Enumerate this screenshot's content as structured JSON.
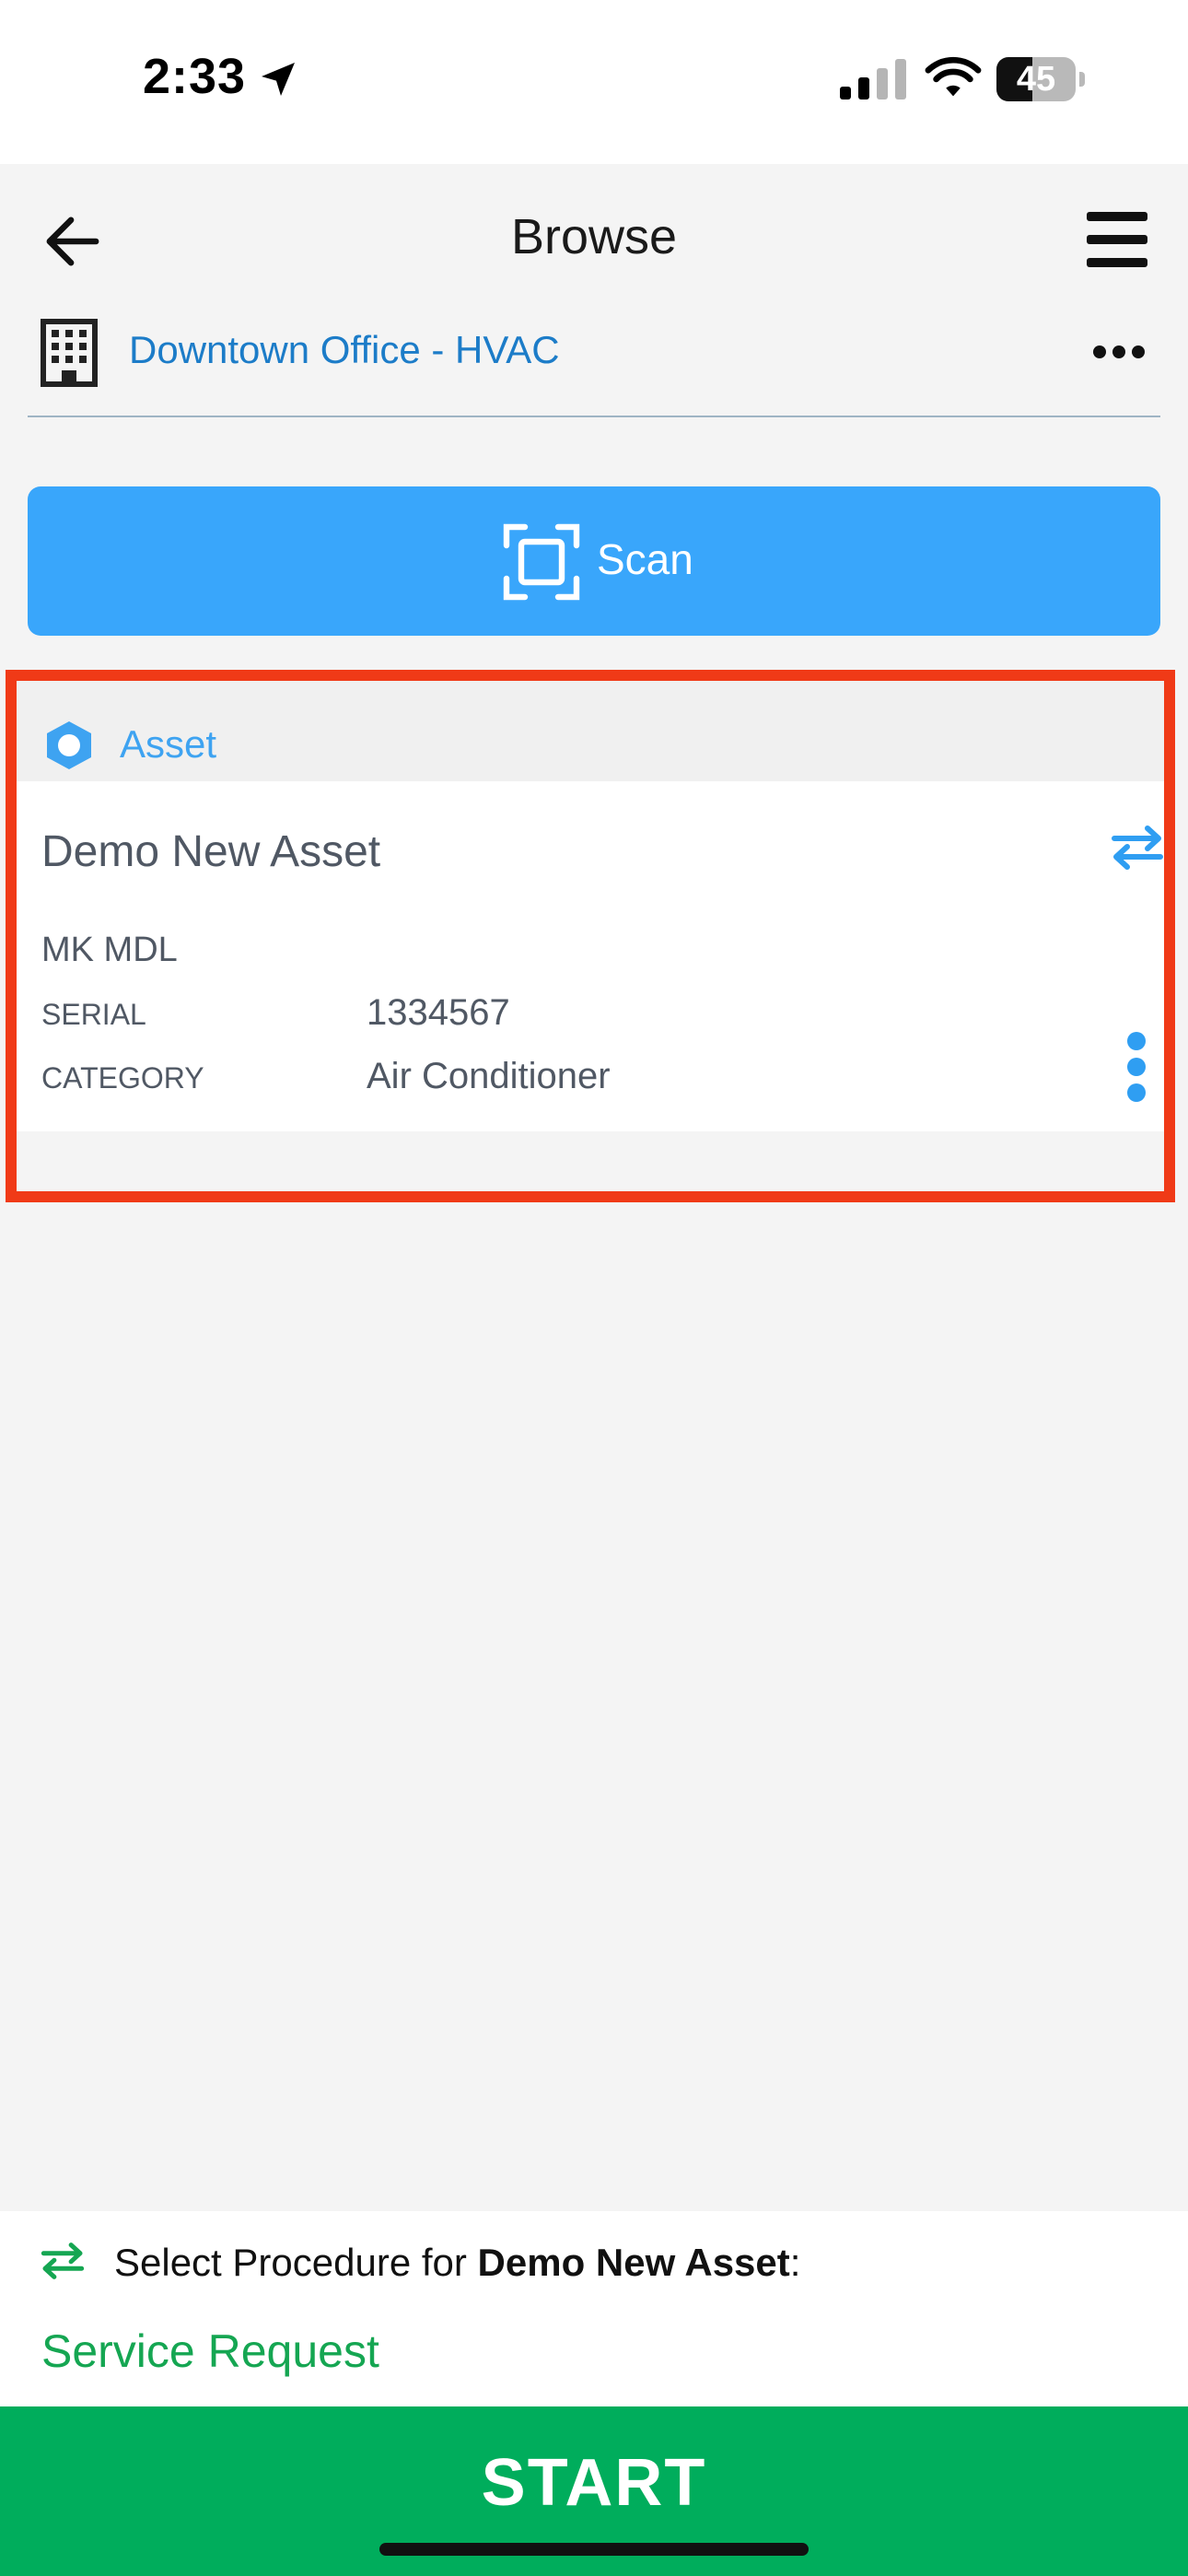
{
  "status_bar": {
    "time": "2:33",
    "battery": "45",
    "battery_level": 0.45,
    "icons": [
      "location-arrow-icon",
      "cellular-signal-icon",
      "wifi-icon",
      "battery-icon"
    ]
  },
  "header": {
    "title": "Browse",
    "back_icon": "arrow-left-icon",
    "menu_icon": "hamburger-menu-icon"
  },
  "location": {
    "icon": "building-icon",
    "name": "Downtown Office - HVAC",
    "more_icon": "more-horizontal-icon"
  },
  "scan": {
    "label": "Scan",
    "icon": "scan-frame-icon"
  },
  "asset": {
    "type_label": "Asset",
    "type_icon": "hexagon-icon",
    "name": "Demo New Asset",
    "make_model": "MK MDL",
    "serial_label": "SERIAL",
    "serial_value": "1334567",
    "category_label": "CATEGORY",
    "category_value": "Air Conditioner",
    "swap_icon": "swap-arrows-icon",
    "more_icon": "more-vertical-icon"
  },
  "procedure": {
    "prefix": "Select Procedure for ",
    "asset_name": "Demo New Asset",
    "suffix": ":",
    "option": "Service Request",
    "icon": "swap-arrows-icon"
  },
  "start": {
    "label": "START"
  },
  "colors": {
    "accent_blue": "#39a6fb",
    "link_blue": "#1c7cc8",
    "green": "#00ad5c",
    "highlight_red": "#f03a17",
    "background": "#f4f4f4"
  }
}
